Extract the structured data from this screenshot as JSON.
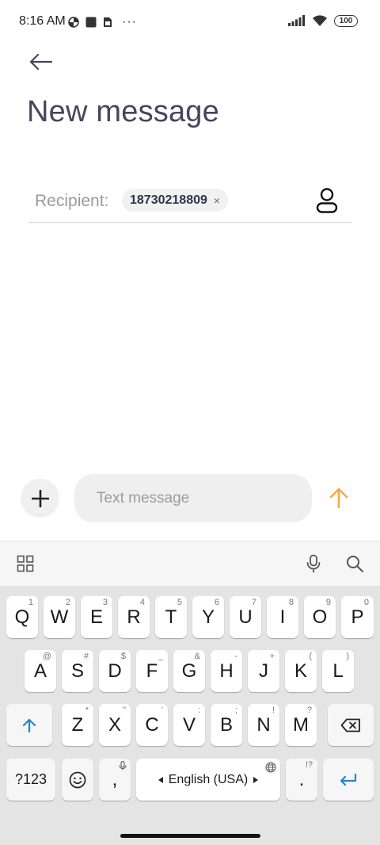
{
  "status_bar": {
    "time": "8:16 AM",
    "dots": "···",
    "battery": "100"
  },
  "header": {
    "title": "New message"
  },
  "recipient": {
    "label": "Recipient:",
    "chip_text": "18730218809",
    "chip_remove": "×"
  },
  "compose": {
    "placeholder": "Text message",
    "send_color": "#f5a84a"
  },
  "keyboard": {
    "row1": [
      {
        "label": "Q",
        "hint": "1"
      },
      {
        "label": "W",
        "hint": "2"
      },
      {
        "label": "E",
        "hint": "3"
      },
      {
        "label": "R",
        "hint": "4"
      },
      {
        "label": "T",
        "hint": "5"
      },
      {
        "label": "Y",
        "hint": "6"
      },
      {
        "label": "U",
        "hint": "7"
      },
      {
        "label": "I",
        "hint": "8"
      },
      {
        "label": "O",
        "hint": "9"
      },
      {
        "label": "P",
        "hint": "0"
      }
    ],
    "row2": [
      {
        "label": "A",
        "hint": "@"
      },
      {
        "label": "S",
        "hint": "#"
      },
      {
        "label": "D",
        "hint": "$"
      },
      {
        "label": "F",
        "hint": "_"
      },
      {
        "label": "G",
        "hint": "&"
      },
      {
        "label": "H",
        "hint": "-"
      },
      {
        "label": "J",
        "hint": "+"
      },
      {
        "label": "K",
        "hint": "("
      },
      {
        "label": "L",
        "hint": ")"
      }
    ],
    "row3": [
      {
        "label": "Z",
        "hint": "*"
      },
      {
        "label": "X",
        "hint": "\""
      },
      {
        "label": "C",
        "hint": "'"
      },
      {
        "label": "V",
        "hint": ":"
      },
      {
        "label": "B",
        "hint": ";"
      },
      {
        "label": "N",
        "hint": "!"
      },
      {
        "label": "M",
        "hint": "?"
      }
    ],
    "symbols_label": "?123",
    "comma_label": ",",
    "space_label": "English (USA)",
    "period_label": ".",
    "period_hint": "!?"
  }
}
